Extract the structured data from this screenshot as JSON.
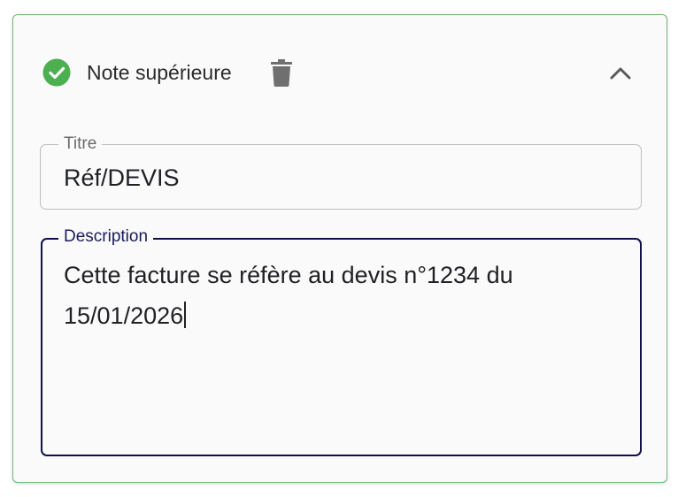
{
  "card": {
    "title": "Note supérieure",
    "accent_color": "#4caf50",
    "border_color": "#79b77a"
  },
  "icons": {
    "status": "check-circle-icon",
    "delete": "trash-icon",
    "collapse": "chevron-up-icon"
  },
  "form": {
    "title_field": {
      "label": "Titre",
      "value": "Réf/DEVIS"
    },
    "description_field": {
      "label": "Description",
      "value": "Cette facture se réfère au devis n°1234 du 15/01/2026",
      "focused": true,
      "focus_color": "#101048"
    }
  }
}
